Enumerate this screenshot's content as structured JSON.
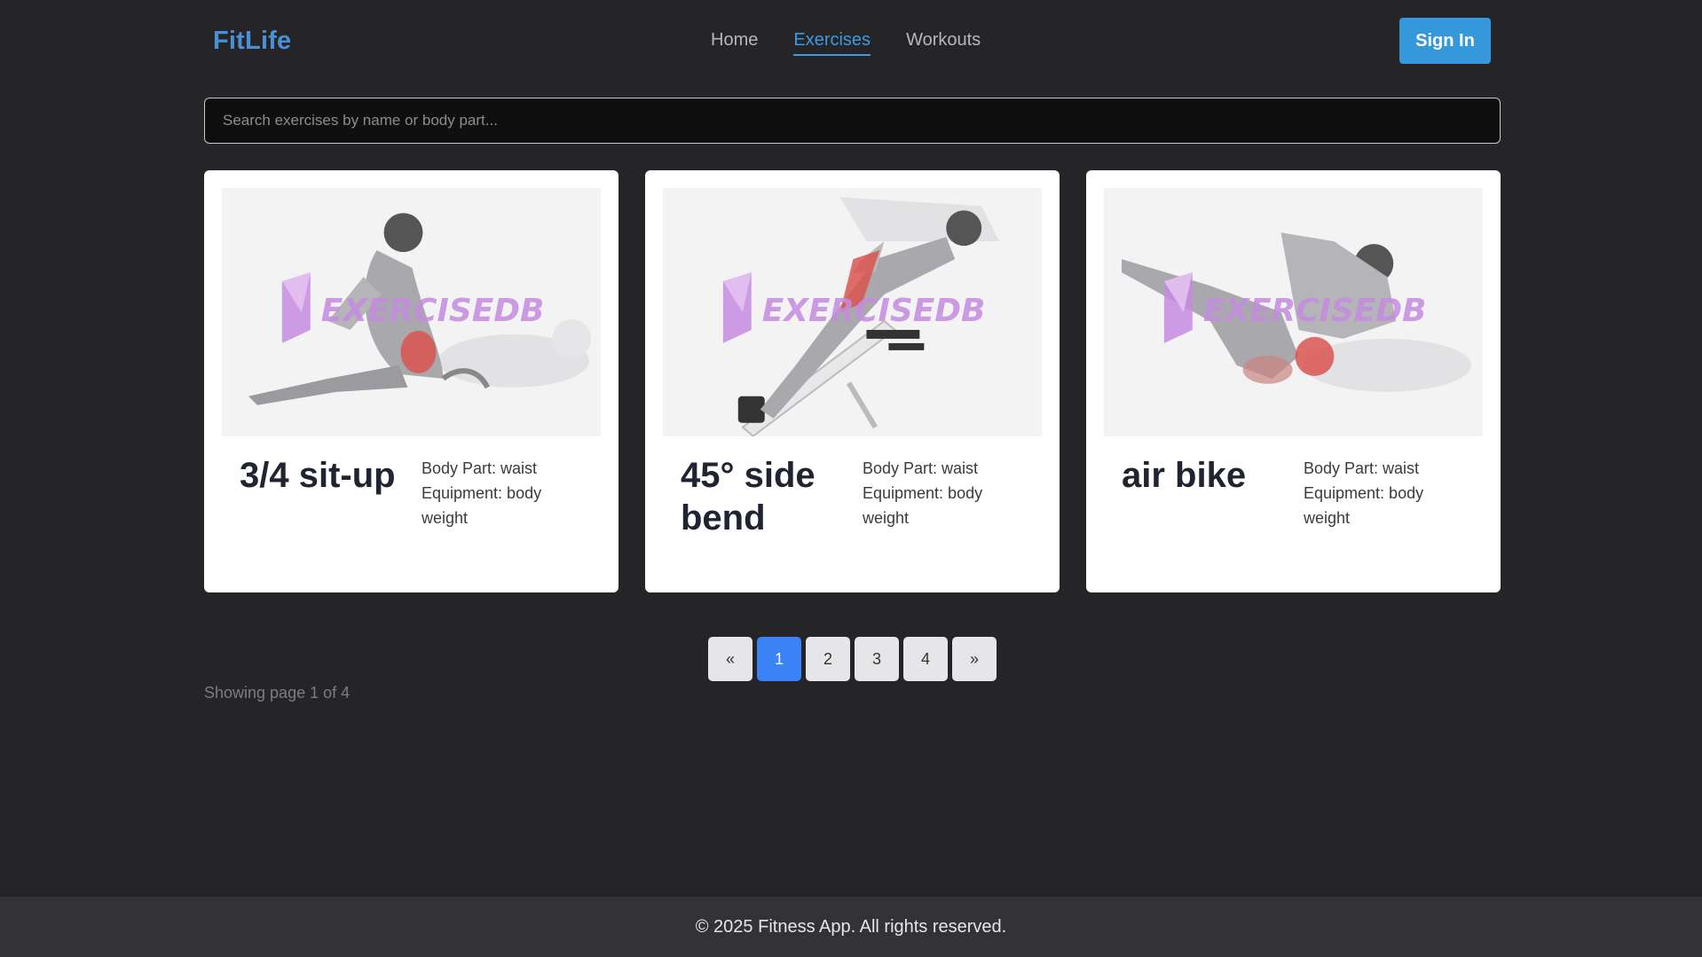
{
  "header": {
    "logo": "FitLife",
    "nav": [
      {
        "label": "Home",
        "active": false
      },
      {
        "label": "Exercises",
        "active": true
      },
      {
        "label": "Workouts",
        "active": false
      }
    ],
    "signin_label": "Sign In"
  },
  "search": {
    "placeholder": "Search exercises by name or body part...",
    "value": ""
  },
  "cards": [
    {
      "name": "3/4 sit-up",
      "body_part": "Body Part: waist",
      "equipment": "Equipment: body weight",
      "watermark": "EXERCISEDB"
    },
    {
      "name": "45° side bend",
      "body_part": "Body Part: waist",
      "equipment": "Equipment: body weight",
      "watermark": "EXERCISEDB"
    },
    {
      "name": "air bike",
      "body_part": "Body Part: waist",
      "equipment": "Equipment: body weight",
      "watermark": "EXERCISEDB"
    }
  ],
  "pagination": {
    "prev": "«",
    "pages": [
      "1",
      "2",
      "3",
      "4"
    ],
    "next": "»",
    "current": 1,
    "info": "Showing page 1 of 4"
  },
  "footer": {
    "text": "© 2025 Fitness App. All rights reserved."
  },
  "colors": {
    "brand": "#4a90d9",
    "accent": "#3498db",
    "active_page": "#3b82f6",
    "muscle_highlight": "#d9534f",
    "watermark": "#c58be0"
  }
}
